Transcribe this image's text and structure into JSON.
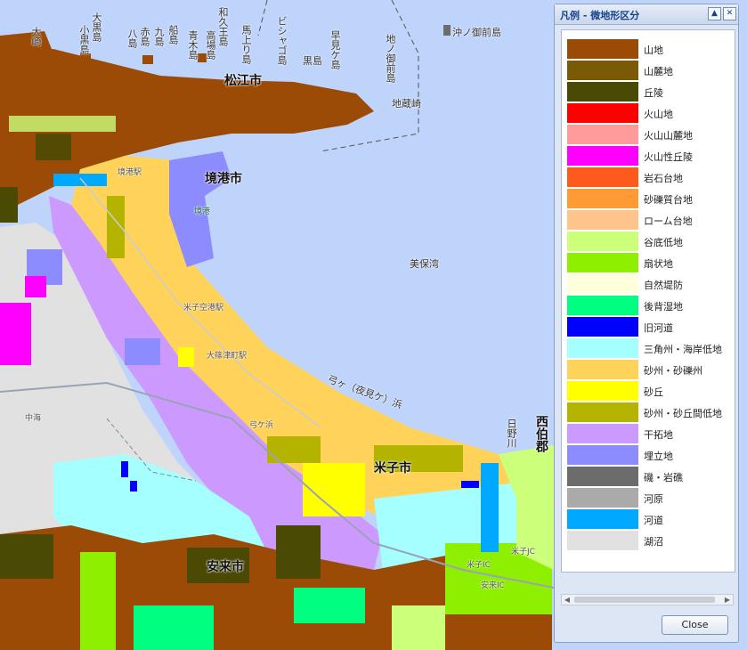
{
  "map": {
    "labels": {
      "matsue": "松江市",
      "sakaiminato": "境港市",
      "yonago": "米子市",
      "yasugi": "安来市",
      "saihaku": "西伯郡",
      "miho_bay": "美保湾",
      "okinomikado": "沖ノ御前島",
      "jinokamimae": "地ノ御前島",
      "kazashima": "地蔵崎",
      "oomisaki": "大崎",
      "oguro": "大黒島",
      "kouroshima": "小黒島",
      "hachijima": "八島",
      "akagashima": "赤島",
      "kumojima": "九島",
      "funajima": "船島",
      "aokijima": "青木島",
      "wakudaishima": "和久王島",
      "takashima": "高場島",
      "umajima": "馬上り島",
      "bishagojima": "ビシャゴ島",
      "kurojima": "黒島",
      "hayagashima": "早見ケ島",
      "sakaiminato_st": "境港駅",
      "yonago_airport": "米子空港駅",
      "yumigahama": "弓ケ浜",
      "yumigahama_coast": "弓ヶ（夜見ケ）浜",
      "hinogawa": "日野川",
      "nakaumi": "中海",
      "yonago_ic": "米子IC",
      "miho_port": "境港",
      "hoshimiya": "大篠津町駅",
      "yonago_jc": "米子JC",
      "yasugi_ic": "安来IC"
    }
  },
  "legend": {
    "title": "凡例 - 微地形区分",
    "minimize_icon": "chevron-up-icon",
    "close_icon": "close-icon",
    "close_button": "Close",
    "items": [
      {
        "label": "山地",
        "color": "#9c4b06"
      },
      {
        "label": "山麓地",
        "color": "#7a5a06"
      },
      {
        "label": "丘陵",
        "color": "#4b4a04"
      },
      {
        "label": "火山地",
        "color": "#ff0000"
      },
      {
        "label": "火山山麓地",
        "color": "#ff9b9b"
      },
      {
        "label": "火山性丘陵",
        "color": "#ff00ff"
      },
      {
        "label": "岩石台地",
        "color": "#ff5a1e"
      },
      {
        "label": "砂礫質台地",
        "color": "#ff9a35"
      },
      {
        "label": "ローム台地",
        "color": "#ffc48c"
      },
      {
        "label": "谷底低地",
        "color": "#ccff7a"
      },
      {
        "label": "扇状地",
        "color": "#8ef000"
      },
      {
        "label": "自然堤防",
        "color": "#ffffdd"
      },
      {
        "label": "後背湿地",
        "color": "#00ff80"
      },
      {
        "label": "旧河道",
        "color": "#0000ff"
      },
      {
        "label": "三角州・海岸低地",
        "color": "#a6ffff"
      },
      {
        "label": "砂州・砂礫州",
        "color": "#ffd25a"
      },
      {
        "label": "砂丘",
        "color": "#ffff00"
      },
      {
        "label": "砂州・砂丘間低地",
        "color": "#b4b400"
      },
      {
        "label": "干拓地",
        "color": "#cc99ff"
      },
      {
        "label": "埋立地",
        "color": "#8c8cff"
      },
      {
        "label": "磯・岩礁",
        "color": "#6c6c6c"
      },
      {
        "label": "河原",
        "color": "#aaaaaa"
      },
      {
        "label": "河道",
        "color": "#00a8ff"
      },
      {
        "label": "湖沼",
        "color": "#e1e1e1"
      }
    ]
  }
}
